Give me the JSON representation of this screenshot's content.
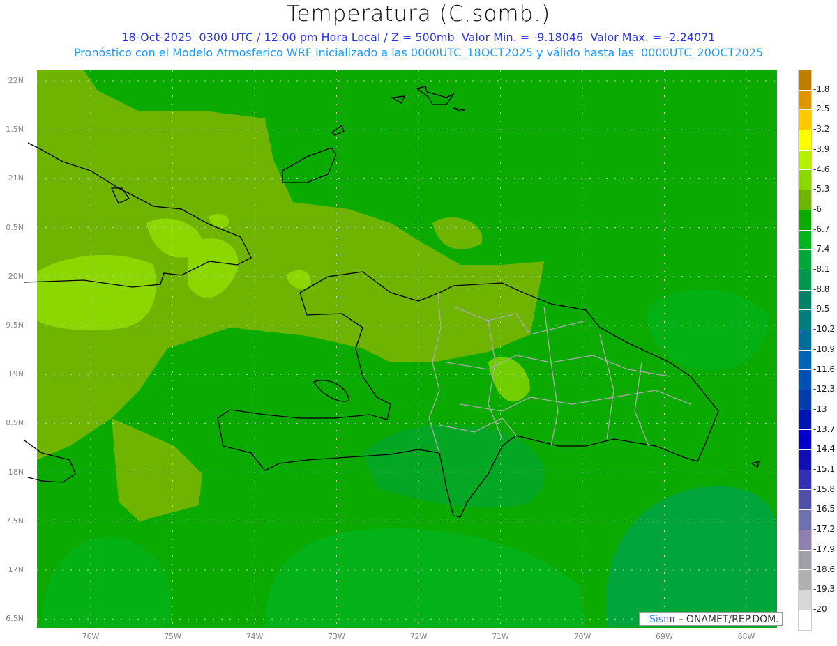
{
  "header": {
    "title": "Temperatura (C,somb.)",
    "line1": "18-Oct-2025  0300 UTC / 12:00 pm Hora Local / Z = 500mb  Valor Min. = -9.18046  Valor Max. = -2.24071",
    "line2": "Pronóstico con el Modelo Atmosferico WRF inicializado a las 0000UTC_18OCT2025 y válido hasta las  0000UTC_20OCT2025"
  },
  "axes": {
    "lat": [
      {
        "v": 22,
        "label": "22N"
      },
      {
        "v": 21.5,
        "label": "1.5N"
      },
      {
        "v": 21,
        "label": "21N"
      },
      {
        "v": 20.5,
        "label": "0.5N"
      },
      {
        "v": 20,
        "label": "20N"
      },
      {
        "v": 19.5,
        "label": "9.5N"
      },
      {
        "v": 19,
        "label": "19N"
      },
      {
        "v": 18.5,
        "label": "8.5N"
      },
      {
        "v": 18,
        "label": "18N"
      },
      {
        "v": 17.5,
        "label": "7.5N"
      },
      {
        "v": 17,
        "label": "17N"
      },
      {
        "v": 16.5,
        "label": "6.5N"
      }
    ],
    "lon": [
      {
        "v": -76,
        "label": "76W"
      },
      {
        "v": -75,
        "label": "75W"
      },
      {
        "v": -74,
        "label": "74W"
      },
      {
        "v": -73,
        "label": "73W"
      },
      {
        "v": -72,
        "label": "72W"
      },
      {
        "v": -71,
        "label": "71W"
      },
      {
        "v": -70,
        "label": "70W"
      },
      {
        "v": -69,
        "label": "69W"
      },
      {
        "v": -68,
        "label": "68W"
      }
    ]
  },
  "colorbar": {
    "labels": [
      "-1.8",
      "-2.5",
      "-3.2",
      "-3.9",
      "-4.6",
      "-5.3",
      "-6",
      "-6.7",
      "-7.4",
      "-8.1",
      "-8.8",
      "-9.5",
      "-10.2",
      "-10.9",
      "-11.6",
      "-12.3",
      "-13",
      "-13.7",
      "-14.4",
      "-15.1",
      "-15.8",
      "-16.5",
      "-17.2",
      "-17.9",
      "-18.6",
      "-19.3",
      "-20"
    ],
    "colors": [
      "#c07e00",
      "#e09600",
      "#ffc800",
      "#ffff00",
      "#b4f000",
      "#8cd700",
      "#6eb400",
      "#0aaa00",
      "#00b41e",
      "#00a53c",
      "#00964b",
      "#008264",
      "#007d7d",
      "#006e96",
      "#0064b4",
      "#0050b4",
      "#003caa",
      "#0014b0",
      "#0000c8",
      "#1010b0",
      "#3030b0",
      "#5050a8",
      "#7070ac",
      "#9080b0",
      "#a0a0a8",
      "#b0b0b0",
      "#d8d8d8",
      "#ffffff"
    ]
  },
  "credit": {
    "sis": "Sis",
    "pi": "ππ",
    "org": " – ONAMET/REP.DOM."
  }
}
